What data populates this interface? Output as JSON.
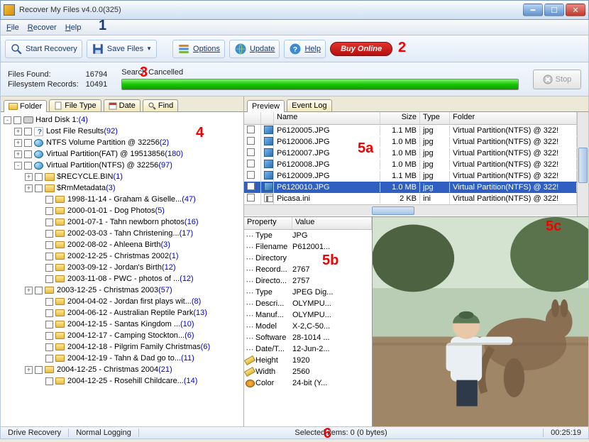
{
  "window": {
    "title": "Recover My Files v4.0.0(325)"
  },
  "menu": {
    "file": "File",
    "recover": "Recover",
    "help": "Help"
  },
  "toolbar": {
    "start_recovery": "Start Recovery",
    "save_files": "Save Files",
    "options": "Options",
    "update": "Update",
    "help": "Help",
    "buy_online": "Buy Online"
  },
  "status": {
    "files_found_label": "Files Found:",
    "files_found_value": "16794",
    "fs_records_label": "Filesystem Records:",
    "fs_records_value": "10491",
    "progress_label": "Search Cancelled",
    "stop": "Stop"
  },
  "left_tabs": {
    "folder": "Folder",
    "file_type": "File Type",
    "date": "Date",
    "find": "Find"
  },
  "tree": [
    {
      "indent": 0,
      "exp": "-",
      "icon": "disk",
      "label": "Hard Disk 1:",
      "count": "(4)"
    },
    {
      "indent": 1,
      "exp": "+",
      "icon": "lost",
      "label": "Lost File Results",
      "count": "(92)"
    },
    {
      "indent": 1,
      "exp": "+",
      "icon": "part",
      "label": "NTFS Volume Partition @ 32256",
      "count": "(2)"
    },
    {
      "indent": 1,
      "exp": "+",
      "icon": "part",
      "label": "Virtual Partition(FAT) @ 19513856",
      "count": "(180)"
    },
    {
      "indent": 1,
      "exp": "-",
      "icon": "part",
      "label": "Virtual Partition(NTFS) @ 32256",
      "count": "(97)"
    },
    {
      "indent": 2,
      "exp": "+",
      "icon": "folderopen",
      "label": "$RECYCLE.BIN",
      "count": "(1)"
    },
    {
      "indent": 2,
      "exp": "+",
      "icon": "folderopen",
      "label": "$RmMetadata",
      "count": "(3)"
    },
    {
      "indent": 3,
      "icon": "folder",
      "label": "1998-11-14 - Graham & Giselle...",
      "count": "(47)"
    },
    {
      "indent": 3,
      "icon": "folder",
      "label": "2000-01-01 - Dog Photos",
      "count": "(5)"
    },
    {
      "indent": 3,
      "icon": "folder",
      "label": "2001-07-1 - Tahn newborn photos",
      "count": "(16)"
    },
    {
      "indent": 3,
      "icon": "folder",
      "label": "2002-03-03 - Tahn Christening...",
      "count": "(17)"
    },
    {
      "indent": 3,
      "icon": "folder",
      "label": "2002-08-02 - Ahleena Birth",
      "count": "(3)"
    },
    {
      "indent": 3,
      "icon": "folder",
      "label": "2002-12-25 - Christmas 2002",
      "count": "(1)"
    },
    {
      "indent": 3,
      "icon": "folder",
      "label": "2003-09-12 - Jordan's Birth",
      "count": "(12)"
    },
    {
      "indent": 3,
      "icon": "folder",
      "label": "2003-11-08 - PWC - photos of ...",
      "count": "(12)"
    },
    {
      "indent": 2,
      "exp": "+",
      "icon": "folder",
      "label": "2003-12-25 - Christmas 2003",
      "count": "(57)"
    },
    {
      "indent": 3,
      "icon": "folder",
      "label": "2004-04-02 - Jordan first plays wit...",
      "count": "(8)"
    },
    {
      "indent": 3,
      "icon": "folder",
      "label": "2004-06-12 - Australian Reptile Park",
      "count": "(13)"
    },
    {
      "indent": 3,
      "icon": "folder",
      "label": "2004-12-15 - Santas Kingdom ...",
      "count": "(10)"
    },
    {
      "indent": 3,
      "icon": "folder",
      "label": "2004-12-17 - Camping Stockton...",
      "count": "(6)"
    },
    {
      "indent": 3,
      "icon": "folder",
      "label": "2004-12-18 - Pilgrim Family Christmas",
      "count": "(6)"
    },
    {
      "indent": 3,
      "icon": "folder",
      "label": "2004-12-19 - Tahn & Dad go to...",
      "count": "(11)"
    },
    {
      "indent": 2,
      "exp": "+",
      "icon": "folder",
      "label": "2004-12-25 - Christmas 2004",
      "count": "(21)"
    },
    {
      "indent": 3,
      "icon": "folder",
      "label": "2004-12-25 - Rosehill Childcare...",
      "count": "(14)"
    }
  ],
  "right_tabs": {
    "preview": "Preview",
    "event_log": "Event Log"
  },
  "file_columns": {
    "name": "Name",
    "size": "Size",
    "type": "Type",
    "folder": "Folder"
  },
  "files": [
    {
      "name": "P6120005.JPG",
      "size": "1.1 MB",
      "type": "jpg",
      "folder": "Virtual Partition(NTFS) @ 322!",
      "sel": false,
      "ico": "img"
    },
    {
      "name": "P6120006.JPG",
      "size": "1.0 MB",
      "type": "jpg",
      "folder": "Virtual Partition(NTFS) @ 322!",
      "sel": false,
      "ico": "img"
    },
    {
      "name": "P6120007.JPG",
      "size": "1.0 MB",
      "type": "jpg",
      "folder": "Virtual Partition(NTFS) @ 322!",
      "sel": false,
      "ico": "img"
    },
    {
      "name": "P6120008.JPG",
      "size": "1.0 MB",
      "type": "jpg",
      "folder": "Virtual Partition(NTFS) @ 322!",
      "sel": false,
      "ico": "img"
    },
    {
      "name": "P6120009.JPG",
      "size": "1.1 MB",
      "type": "jpg",
      "folder": "Virtual Partition(NTFS) @ 322!",
      "sel": false,
      "ico": "img"
    },
    {
      "name": "P6120010.JPG",
      "size": "1.0 MB",
      "type": "jpg",
      "folder": "Virtual Partition(NTFS) @ 322!",
      "sel": true,
      "ico": "img"
    },
    {
      "name": "Picasa.ini",
      "size": "2 KB",
      "type": "ini",
      "folder": "Virtual Partition(NTFS) @ 322!",
      "sel": false,
      "ico": "ini"
    }
  ],
  "prop_columns": {
    "property": "Property",
    "value": "Value"
  },
  "props": [
    {
      "k": "Type",
      "v": "JPG",
      "ico": "dots"
    },
    {
      "k": "Filename",
      "v": "P612001...",
      "ico": "dots"
    },
    {
      "k": "Directory",
      "v": "",
      "ico": "dots"
    },
    {
      "k": "Record...",
      "v": "2767",
      "ico": "dots"
    },
    {
      "k": "Directo...",
      "v": "2757",
      "ico": "dots"
    },
    {
      "k": "Type",
      "v": "JPEG Dig...",
      "ico": "dots"
    },
    {
      "k": "Descri...",
      "v": "OLYMPU...",
      "ico": "dots"
    },
    {
      "k": "Manuf...",
      "v": "OLYMPU...",
      "ico": "dots"
    },
    {
      "k": "Model",
      "v": "X-2,C-50...",
      "ico": "dots"
    },
    {
      "k": "Software",
      "v": "28-1014 ...",
      "ico": "dots"
    },
    {
      "k": "Date/T...",
      "v": "12-Jun-2...",
      "ico": "dots"
    },
    {
      "k": "Height",
      "v": "1920",
      "ico": "ruler"
    },
    {
      "k": "Width",
      "v": "2560",
      "ico": "ruler"
    },
    {
      "k": "Color",
      "v": "24-bit (Y...",
      "ico": "palette"
    }
  ],
  "statusbar": {
    "mode": "Drive Recovery",
    "logging": "Normal Logging",
    "selected": "Selected items: 0 (0 bytes)",
    "time": "00:25:19"
  },
  "annotations": {
    "a1": "1",
    "a2": "2",
    "a3": "3",
    "a4": "4",
    "a5a": "5a",
    "a5b": "5b",
    "a5c": "5c",
    "a6": "6"
  }
}
